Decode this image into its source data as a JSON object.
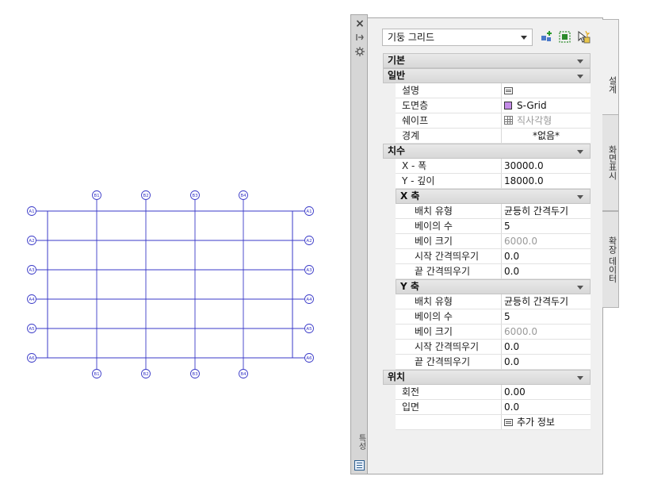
{
  "grid": {
    "rows": [
      "A1",
      "A2",
      "A3",
      "A4",
      "A5",
      "A6"
    ],
    "cols_top": [
      "B1",
      "B2",
      "B3",
      "B4"
    ],
    "cols_bottom": [
      "B1",
      "B2",
      "B3",
      "B4"
    ],
    "line_color": "#3a3ac8"
  },
  "palette": {
    "close_icon": "×",
    "pin_icon": "pin-icon",
    "settings_icon": "settings-icon",
    "strip_label": "특성",
    "style_select": "기둥 그리드",
    "tabs": [
      "설계",
      "화면표시",
      "확장 데이터"
    ],
    "sections": {
      "basic": "기본",
      "general": "일반",
      "dimensions": "치수",
      "x_axis": "X 축",
      "y_axis": "Y 축",
      "location": "위치"
    },
    "general": {
      "description_label": "설명",
      "layer_label": "도면층",
      "layer_value": "S-Grid",
      "shape_label": "쉐이프",
      "shape_value": "직사각형",
      "boundary_label": "경계",
      "boundary_value": "*없음*"
    },
    "dimensions": {
      "x_width_label": "X - 폭",
      "x_width_value": "30000.0",
      "y_depth_label": "Y - 깊이",
      "y_depth_value": "18000.0"
    },
    "x_axis": {
      "layout_type_label": "배치 유형",
      "layout_type_value": "균등히 간격두기",
      "bay_count_label": "베이의 수",
      "bay_count_value": "5",
      "bay_size_label": "베이 크기",
      "bay_size_value": "6000.0",
      "start_offset_label": "시작 간격띄우기",
      "start_offset_value": "0.0",
      "end_offset_label": "끝 간격띄우기",
      "end_offset_value": "0.0"
    },
    "y_axis": {
      "layout_type_label": "배치 유형",
      "layout_type_value": "균등히 간격두기",
      "bay_count_label": "베이의 수",
      "bay_count_value": "5",
      "bay_size_label": "베이 크기",
      "bay_size_value": "6000.0",
      "start_offset_label": "시작 간격띄우기",
      "start_offset_value": "0.0",
      "end_offset_label": "끝 간격띄우기",
      "end_offset_value": "0.0"
    },
    "location": {
      "rotation_label": "회전",
      "rotation_value": "0.00",
      "elevation_label": "입면",
      "elevation_value": "0.0",
      "extra_info": "추가 정보"
    }
  }
}
